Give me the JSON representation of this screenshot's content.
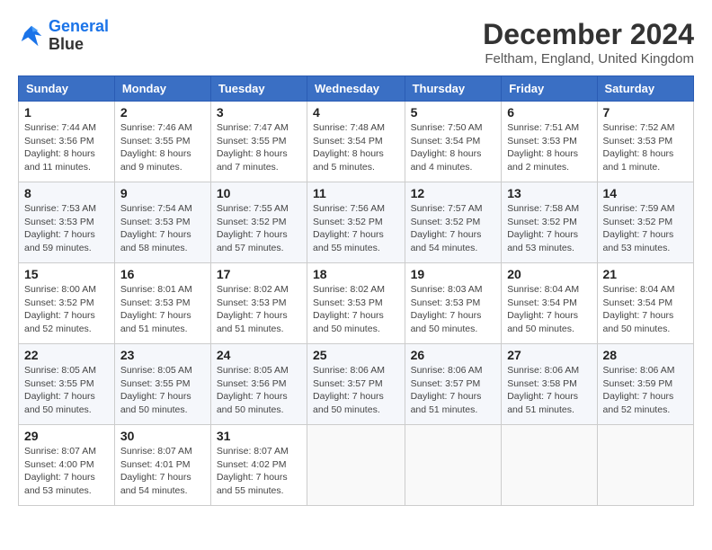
{
  "logo": {
    "line1": "General",
    "line2": "Blue"
  },
  "title": "December 2024",
  "location": "Feltham, England, United Kingdom",
  "weekdays": [
    "Sunday",
    "Monday",
    "Tuesday",
    "Wednesday",
    "Thursday",
    "Friday",
    "Saturday"
  ],
  "weeks": [
    [
      {
        "day": "1",
        "info": "Sunrise: 7:44 AM\nSunset: 3:56 PM\nDaylight: 8 hours\nand 11 minutes."
      },
      {
        "day": "2",
        "info": "Sunrise: 7:46 AM\nSunset: 3:55 PM\nDaylight: 8 hours\nand 9 minutes."
      },
      {
        "day": "3",
        "info": "Sunrise: 7:47 AM\nSunset: 3:55 PM\nDaylight: 8 hours\nand 7 minutes."
      },
      {
        "day": "4",
        "info": "Sunrise: 7:48 AM\nSunset: 3:54 PM\nDaylight: 8 hours\nand 5 minutes."
      },
      {
        "day": "5",
        "info": "Sunrise: 7:50 AM\nSunset: 3:54 PM\nDaylight: 8 hours\nand 4 minutes."
      },
      {
        "day": "6",
        "info": "Sunrise: 7:51 AM\nSunset: 3:53 PM\nDaylight: 8 hours\nand 2 minutes."
      },
      {
        "day": "7",
        "info": "Sunrise: 7:52 AM\nSunset: 3:53 PM\nDaylight: 8 hours\nand 1 minute."
      }
    ],
    [
      {
        "day": "8",
        "info": "Sunrise: 7:53 AM\nSunset: 3:53 PM\nDaylight: 7 hours\nand 59 minutes."
      },
      {
        "day": "9",
        "info": "Sunrise: 7:54 AM\nSunset: 3:53 PM\nDaylight: 7 hours\nand 58 minutes."
      },
      {
        "day": "10",
        "info": "Sunrise: 7:55 AM\nSunset: 3:52 PM\nDaylight: 7 hours\nand 57 minutes."
      },
      {
        "day": "11",
        "info": "Sunrise: 7:56 AM\nSunset: 3:52 PM\nDaylight: 7 hours\nand 55 minutes."
      },
      {
        "day": "12",
        "info": "Sunrise: 7:57 AM\nSunset: 3:52 PM\nDaylight: 7 hours\nand 54 minutes."
      },
      {
        "day": "13",
        "info": "Sunrise: 7:58 AM\nSunset: 3:52 PM\nDaylight: 7 hours\nand 53 minutes."
      },
      {
        "day": "14",
        "info": "Sunrise: 7:59 AM\nSunset: 3:52 PM\nDaylight: 7 hours\nand 53 minutes."
      }
    ],
    [
      {
        "day": "15",
        "info": "Sunrise: 8:00 AM\nSunset: 3:52 PM\nDaylight: 7 hours\nand 52 minutes."
      },
      {
        "day": "16",
        "info": "Sunrise: 8:01 AM\nSunset: 3:53 PM\nDaylight: 7 hours\nand 51 minutes."
      },
      {
        "day": "17",
        "info": "Sunrise: 8:02 AM\nSunset: 3:53 PM\nDaylight: 7 hours\nand 51 minutes."
      },
      {
        "day": "18",
        "info": "Sunrise: 8:02 AM\nSunset: 3:53 PM\nDaylight: 7 hours\nand 50 minutes."
      },
      {
        "day": "19",
        "info": "Sunrise: 8:03 AM\nSunset: 3:53 PM\nDaylight: 7 hours\nand 50 minutes."
      },
      {
        "day": "20",
        "info": "Sunrise: 8:04 AM\nSunset: 3:54 PM\nDaylight: 7 hours\nand 50 minutes."
      },
      {
        "day": "21",
        "info": "Sunrise: 8:04 AM\nSunset: 3:54 PM\nDaylight: 7 hours\nand 50 minutes."
      }
    ],
    [
      {
        "day": "22",
        "info": "Sunrise: 8:05 AM\nSunset: 3:55 PM\nDaylight: 7 hours\nand 50 minutes."
      },
      {
        "day": "23",
        "info": "Sunrise: 8:05 AM\nSunset: 3:55 PM\nDaylight: 7 hours\nand 50 minutes."
      },
      {
        "day": "24",
        "info": "Sunrise: 8:05 AM\nSunset: 3:56 PM\nDaylight: 7 hours\nand 50 minutes."
      },
      {
        "day": "25",
        "info": "Sunrise: 8:06 AM\nSunset: 3:57 PM\nDaylight: 7 hours\nand 50 minutes."
      },
      {
        "day": "26",
        "info": "Sunrise: 8:06 AM\nSunset: 3:57 PM\nDaylight: 7 hours\nand 51 minutes."
      },
      {
        "day": "27",
        "info": "Sunrise: 8:06 AM\nSunset: 3:58 PM\nDaylight: 7 hours\nand 51 minutes."
      },
      {
        "day": "28",
        "info": "Sunrise: 8:06 AM\nSunset: 3:59 PM\nDaylight: 7 hours\nand 52 minutes."
      }
    ],
    [
      {
        "day": "29",
        "info": "Sunrise: 8:07 AM\nSunset: 4:00 PM\nDaylight: 7 hours\nand 53 minutes."
      },
      {
        "day": "30",
        "info": "Sunrise: 8:07 AM\nSunset: 4:01 PM\nDaylight: 7 hours\nand 54 minutes."
      },
      {
        "day": "31",
        "info": "Sunrise: 8:07 AM\nSunset: 4:02 PM\nDaylight: 7 hours\nand 55 minutes."
      },
      null,
      null,
      null,
      null
    ]
  ]
}
